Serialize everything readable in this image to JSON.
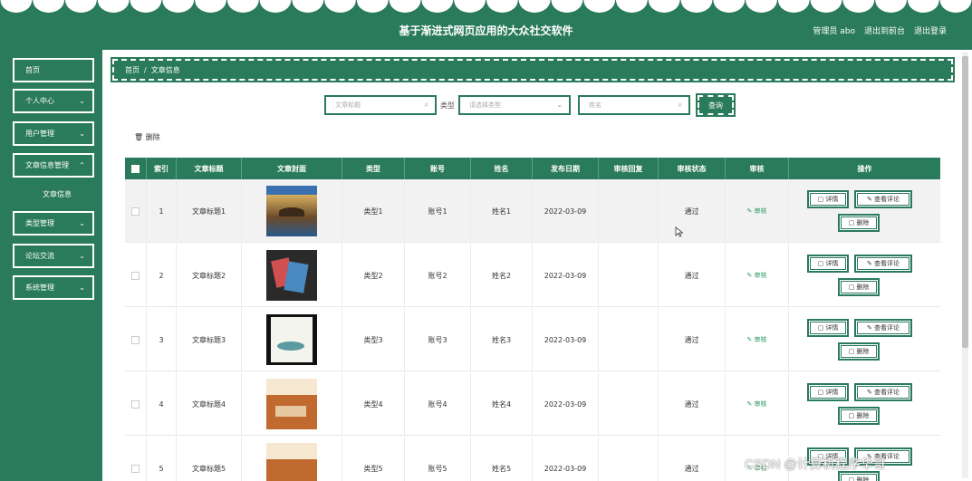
{
  "header": {
    "title": "基于渐进式网页应用的大众社交软件",
    "user": "管理员 abo",
    "back_label": "退出到前台",
    "logout_label": "退出登录"
  },
  "sidebar": {
    "items": [
      {
        "label": "首页",
        "has_chevron": false
      },
      {
        "label": "个人中心",
        "has_chevron": true
      },
      {
        "label": "用户管理",
        "has_chevron": true
      },
      {
        "label": "文章信息管理",
        "has_chevron": true
      },
      {
        "label": "类型管理",
        "has_chevron": true
      },
      {
        "label": "论坛交流",
        "has_chevron": true
      },
      {
        "label": "系统管理",
        "has_chevron": true
      }
    ],
    "submenu_label": "文章信息"
  },
  "breadcrumb": {
    "home": "首页",
    "sep": "/",
    "current": "文章信息"
  },
  "search": {
    "title_placeholder": "文章标题",
    "type_label": "类型",
    "type_placeholder": "请选择类型",
    "name_placeholder": "姓名",
    "query_label": "查询"
  },
  "toolbar": {
    "delete_label": "删除"
  },
  "table": {
    "headers": [
      "索引",
      "文章标题",
      "文章封面",
      "类型",
      "账号",
      "姓名",
      "发布日期",
      "审核回复",
      "审核状态",
      "审核",
      "操作"
    ],
    "rows": [
      {
        "index": "1",
        "title": "文章标题1",
        "type": "类型1",
        "account": "账号1",
        "name": "姓名1",
        "date": "2022-03-09",
        "reply": "",
        "status": "通过",
        "audit": "审核"
      },
      {
        "index": "2",
        "title": "文章标题2",
        "type": "类型2",
        "account": "账号2",
        "name": "姓名2",
        "date": "2022-03-09",
        "reply": "",
        "status": "通过",
        "audit": "审核"
      },
      {
        "index": "3",
        "title": "文章标题3",
        "type": "类型3",
        "account": "账号3",
        "name": "姓名3",
        "date": "2022-03-09",
        "reply": "",
        "status": "通过",
        "audit": "审核"
      },
      {
        "index": "4",
        "title": "文章标题4",
        "type": "类型4",
        "account": "账号4",
        "name": "姓名4",
        "date": "2022-03-09",
        "reply": "",
        "status": "通过",
        "audit": "审核"
      },
      {
        "index": "5",
        "title": "文章标题5",
        "type": "类型5",
        "account": "账号5",
        "name": "姓名5",
        "date": "2022-03-09",
        "reply": "",
        "status": "通过",
        "audit": "审核"
      }
    ],
    "ops": {
      "detail": "详情",
      "comments": "查看评论",
      "delete": "删除"
    }
  },
  "watermark": "CSDN @计算机程序华哥",
  "colors": {
    "primary": "#2a7a5c",
    "audit_green": "#2a9a5c"
  },
  "icons": [
    "search-icon",
    "chevron-down-icon",
    "trash-icon",
    "edit-icon",
    "doc-icon",
    "mouse-cursor-icon"
  ]
}
